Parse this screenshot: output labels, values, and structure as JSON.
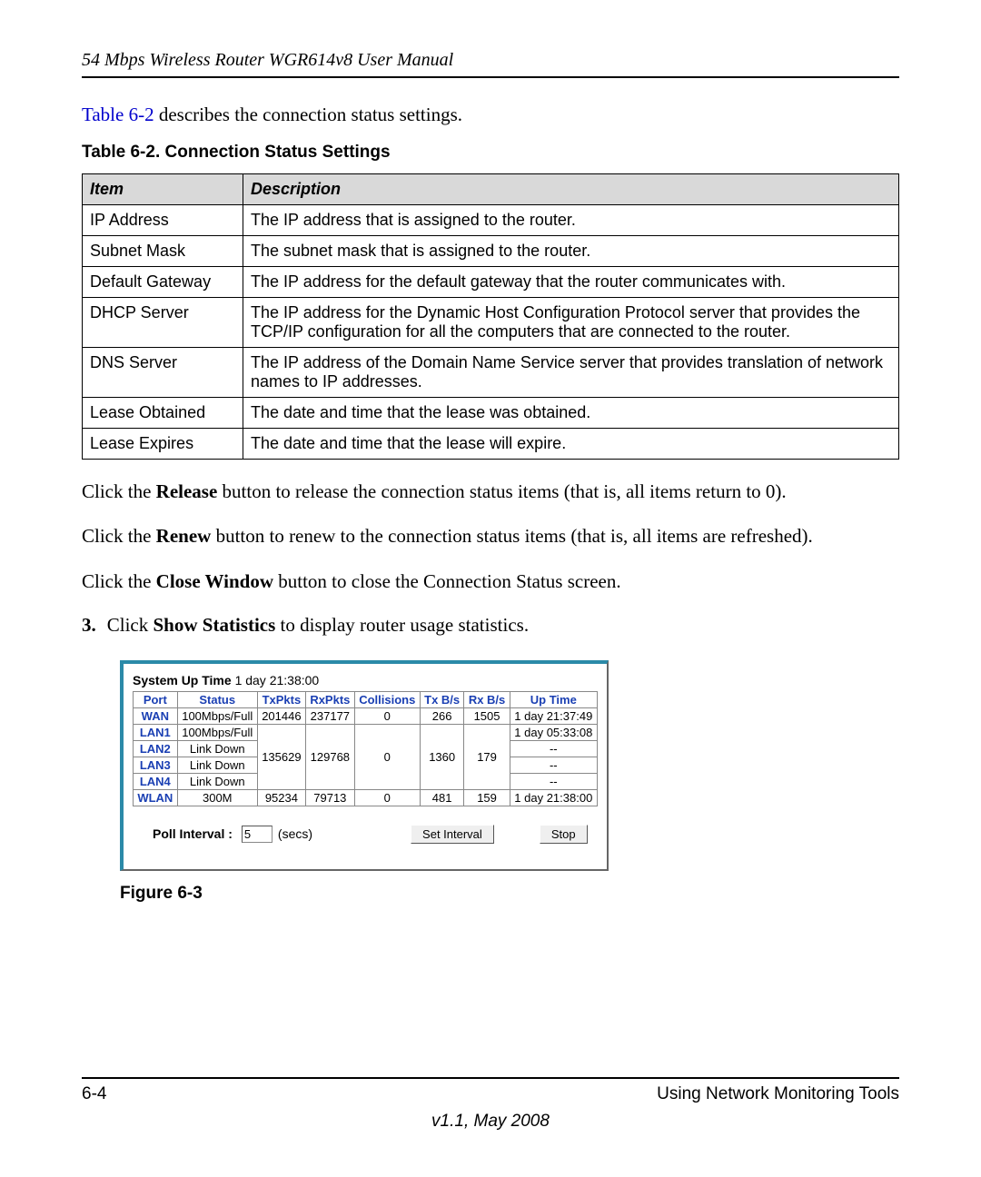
{
  "header": "54 Mbps Wireless Router WGR614v8 User Manual",
  "intro": {
    "link_text": "Table 6-2",
    "rest": " describes the connection status settings."
  },
  "table_caption": "Table 6-2. Connection Status Settings",
  "settings_table": {
    "headers": {
      "item": "Item",
      "desc": "Description"
    },
    "rows": [
      {
        "item": "IP Address",
        "desc": "The IP address that is assigned to the router."
      },
      {
        "item": "Subnet Mask",
        "desc": "The subnet mask that is assigned to the router."
      },
      {
        "item": "Default Gateway",
        "desc": "The IP address for the default gateway that the router communicates with."
      },
      {
        "item": "DHCP Server",
        "desc": "The IP address for the Dynamic Host Configuration Protocol server that provides the TCP/IP configuration for all the computers that are connected to the router."
      },
      {
        "item": "DNS Server",
        "desc": "The IP address of the Domain Name Service server that provides translation of network names to IP addresses."
      },
      {
        "item": "Lease Obtained",
        "desc": "The date and time that the lease was obtained."
      },
      {
        "item": "Lease Expires",
        "desc": "The date and time that the lease will expire."
      }
    ]
  },
  "paragraphs": {
    "release": {
      "pre": "Click the ",
      "bold": "Release",
      "post": " button to release the connection status items (that is, all items return to 0)."
    },
    "renew": {
      "pre": "Click the ",
      "bold": "Renew",
      "post": " button to renew to the connection status items (that is, all items are refreshed)."
    },
    "close": {
      "pre": "Click the ",
      "bold": "Close Window",
      "post": " button to close the Connection Status screen."
    }
  },
  "step": {
    "num": "3.",
    "pre": "Click ",
    "bold": "Show Statistics",
    "post": " to display router usage statistics."
  },
  "stats": {
    "uptime_label": "System Up Time",
    "uptime_value": "1 day 21:38:00",
    "headers": [
      "Port",
      "Status",
      "TxPkts",
      "RxPkts",
      "Collisions",
      "Tx B/s",
      "Rx B/s",
      "Up Time"
    ],
    "wan": {
      "port": "WAN",
      "status": "100Mbps/Full",
      "tx": "201446",
      "rx": "237177",
      "col": "0",
      "txbs": "266",
      "rxbs": "1505",
      "up": "1 day 21:37:49"
    },
    "lan1": {
      "port": "LAN1",
      "status": "100Mbps/Full",
      "up": "1 day 05:33:08"
    },
    "lan2": {
      "port": "LAN2",
      "status": "Link Down",
      "up": "--"
    },
    "lan3": {
      "port": "LAN3",
      "status": "Link Down",
      "up": "--"
    },
    "lan4": {
      "port": "LAN4",
      "status": "Link Down",
      "up": "--"
    },
    "lan_group": {
      "tx": "135629",
      "rx": "129768",
      "col": "0",
      "txbs": "1360",
      "rxbs": "179"
    },
    "wlan": {
      "port": "WLAN",
      "status": "300M",
      "tx": "95234",
      "rx": "79713",
      "col": "0",
      "txbs": "481",
      "rxbs": "159",
      "up": "1 day 21:38:00"
    },
    "poll_label": "Poll Interval :",
    "poll_value": "5",
    "poll_unit": "(secs)",
    "set_interval": "Set Interval",
    "stop": "Stop"
  },
  "figure_caption": "Figure 6-3",
  "footer": {
    "page": "6-4",
    "section": "Using Network Monitoring Tools",
    "version": "v1.1, May 2008"
  }
}
